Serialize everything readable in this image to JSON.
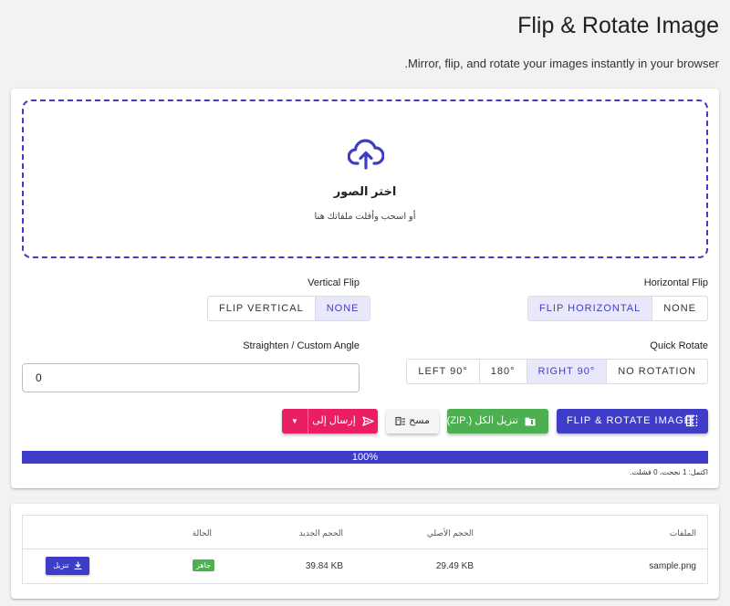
{
  "header": {
    "title": "Flip & Rotate Image",
    "subtitle": "Mirror, flip, and rotate your images instantly in your browser."
  },
  "dropzone": {
    "title": "اختر الصور",
    "hint": "أو اسحب وأفلت ملفاتك هنا"
  },
  "vertical_flip": {
    "label": "Vertical Flip",
    "options": [
      "FLIP VERTICAL",
      "NONE"
    ],
    "selected": "NONE"
  },
  "horizontal_flip": {
    "label": "Horizontal Flip",
    "options": [
      "FLIP HORIZONTAL",
      "NONE"
    ],
    "selected": "FLIP HORIZONTAL"
  },
  "custom_angle": {
    "label": "Straighten / Custom Angle",
    "value": "0"
  },
  "quick_rotate": {
    "label": "Quick Rotate",
    "options": [
      "LEFT 90°",
      "180°",
      "RIGHT 90°",
      "NO ROTATION"
    ],
    "selected": "RIGHT 90°"
  },
  "actions": {
    "primary": "FLIP & ROTATE IMAGE",
    "download_zip": "تنزيل الكل (.ZIP)",
    "clear": "مسح",
    "send_to": "إرسال إلى"
  },
  "progress": {
    "percent": 100,
    "label": "100%",
    "status": "اكتمل: 1 نجحت، 0 فشلت."
  },
  "results": {
    "columns": [
      "الملفات",
      "الحجم الأصلي",
      "الحجم الجديد",
      "الحالة"
    ],
    "rows": [
      {
        "file": "sample.png",
        "original_size": "29.49 KB",
        "new_size": "39.84 KB",
        "status": "جاهز",
        "download": "تنزيل"
      }
    ]
  },
  "colors": {
    "primary": "#3f3dc8",
    "success": "#4caf50",
    "send": "#e91e63",
    "active_segment_bg": "#e8e8fa"
  }
}
